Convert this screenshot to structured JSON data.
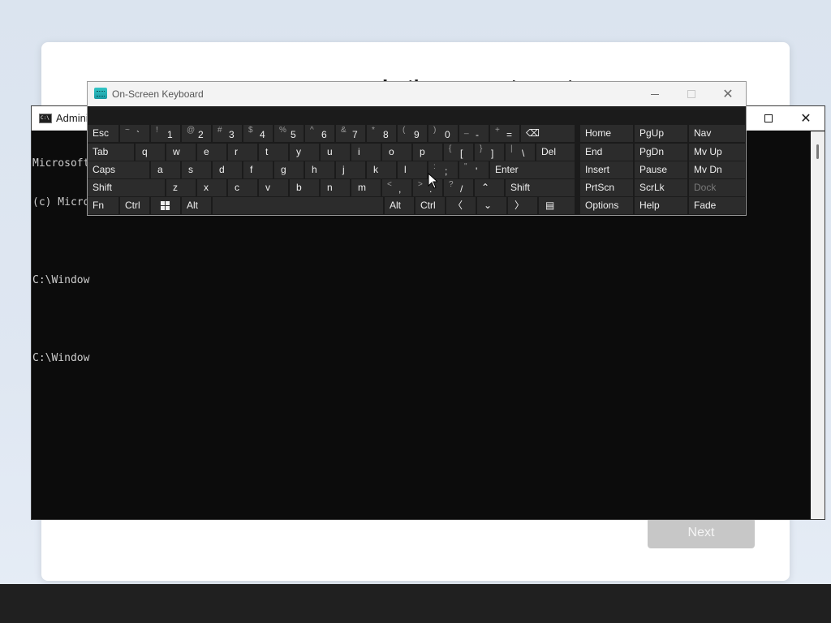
{
  "setup": {
    "heading": "Let's connect you to",
    "next_label": "Next"
  },
  "cmd": {
    "title": "Admini",
    "lines": [
      "Microsoft",
      "(c) Micro",
      "",
      "C:\\Window",
      "",
      "C:\\Window"
    ]
  },
  "osk": {
    "title": "On-Screen Keyboard",
    "row1": [
      {
        "name": "esc",
        "main": "Esc"
      },
      {
        "name": "backtick",
        "shift": "~",
        "main": "`"
      },
      {
        "name": "1",
        "shift": "!",
        "main": "1"
      },
      {
        "name": "2",
        "shift": "@",
        "main": "2"
      },
      {
        "name": "3",
        "shift": "#",
        "main": "3"
      },
      {
        "name": "4",
        "shift": "$",
        "main": "4"
      },
      {
        "name": "5",
        "shift": "%",
        "main": "5"
      },
      {
        "name": "6",
        "shift": "^",
        "main": "6"
      },
      {
        "name": "7",
        "shift": "&",
        "main": "7"
      },
      {
        "name": "8",
        "shift": "*",
        "main": "8"
      },
      {
        "name": "9",
        "shift": "(",
        "main": "9"
      },
      {
        "name": "0",
        "shift": ")",
        "main": "0"
      },
      {
        "name": "minus",
        "shift": "_",
        "main": "-"
      },
      {
        "name": "equals",
        "shift": "+",
        "main": "="
      },
      {
        "name": "backspace",
        "main": "⌫"
      }
    ],
    "row2": [
      {
        "name": "tab",
        "main": "Tab"
      },
      {
        "name": "q",
        "main": "q"
      },
      {
        "name": "w",
        "main": "w"
      },
      {
        "name": "e",
        "main": "e"
      },
      {
        "name": "r",
        "main": "r"
      },
      {
        "name": "t",
        "main": "t"
      },
      {
        "name": "y",
        "main": "y"
      },
      {
        "name": "u",
        "main": "u"
      },
      {
        "name": "i",
        "main": "i"
      },
      {
        "name": "o",
        "main": "o"
      },
      {
        "name": "p",
        "main": "p"
      },
      {
        "name": "lbracket",
        "shift": "{",
        "main": "["
      },
      {
        "name": "rbracket",
        "shift": "}",
        "main": "]"
      },
      {
        "name": "backslash",
        "shift": "|",
        "main": "\\"
      },
      {
        "name": "del",
        "main": "Del"
      }
    ],
    "row3": [
      {
        "name": "caps",
        "main": "Caps"
      },
      {
        "name": "a",
        "main": "a"
      },
      {
        "name": "s",
        "main": "s"
      },
      {
        "name": "d",
        "main": "d"
      },
      {
        "name": "f",
        "main": "f"
      },
      {
        "name": "g",
        "main": "g"
      },
      {
        "name": "h",
        "main": "h"
      },
      {
        "name": "j",
        "main": "j"
      },
      {
        "name": "k",
        "main": "k"
      },
      {
        "name": "l",
        "main": "l"
      },
      {
        "name": "semicolon",
        "shift": ":",
        "main": ";"
      },
      {
        "name": "quote",
        "shift": "\"",
        "main": "'"
      },
      {
        "name": "enter",
        "main": "Enter"
      }
    ],
    "row4": [
      {
        "name": "shift-left",
        "main": "Shift"
      },
      {
        "name": "z",
        "main": "z"
      },
      {
        "name": "x",
        "main": "x"
      },
      {
        "name": "c",
        "main": "c"
      },
      {
        "name": "v",
        "main": "v"
      },
      {
        "name": "b",
        "main": "b"
      },
      {
        "name": "n",
        "main": "n"
      },
      {
        "name": "m",
        "main": "m"
      },
      {
        "name": "comma",
        "shift": "<",
        "main": ","
      },
      {
        "name": "period",
        "shift": ">",
        "main": "."
      },
      {
        "name": "slash",
        "shift": "?",
        "main": "/"
      },
      {
        "name": "up",
        "main": "⌃"
      },
      {
        "name": "shift-right",
        "main": "Shift"
      }
    ],
    "row5": [
      {
        "name": "fn",
        "main": "Fn"
      },
      {
        "name": "ctrl-left",
        "main": "Ctrl"
      },
      {
        "name": "windows",
        "main": ""
      },
      {
        "name": "alt-left",
        "main": "Alt"
      },
      {
        "name": "space",
        "main": ""
      },
      {
        "name": "alt-right",
        "main": "Alt"
      },
      {
        "name": "ctrl-right",
        "main": "Ctrl"
      },
      {
        "name": "left",
        "main": "〈"
      },
      {
        "name": "down",
        "main": "⌄"
      },
      {
        "name": "right",
        "main": "〉"
      },
      {
        "name": "menu",
        "main": "▤"
      }
    ],
    "nav1": [
      "Home",
      "End",
      "Insert",
      "PrtScn",
      "Options"
    ],
    "nav2": [
      "PgUp",
      "PgDn",
      "Pause",
      "ScrLk",
      "Help"
    ],
    "nav3": [
      "Nav",
      "Mv Up",
      "Mv Dn",
      "Dock",
      "Fade"
    ]
  }
}
